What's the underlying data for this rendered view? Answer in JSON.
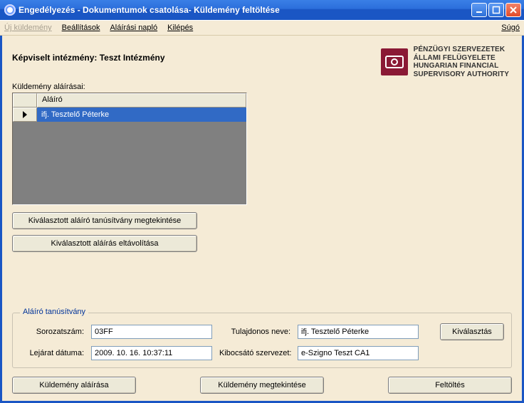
{
  "window": {
    "title": "Engedélyezés - Dokumentumok csatolása- Küldemény feltöltése"
  },
  "menu": {
    "new_shipment": "Új küldemény",
    "settings": "Beállítások",
    "sign_log": "Aláírási napló",
    "exit": "Kilépés",
    "help": "Súgó"
  },
  "authority": {
    "line1": "PÉNZÜGYI SZERVEZETEK",
    "line2": "ÁLLAMI FELÜGYELETE",
    "line3": "HUNGARIAN FINANCIAL",
    "line4": "SUPERVISORY AUTHORITY"
  },
  "header": {
    "institution_label": "Képviselt intézmény: Teszt Intézmény"
  },
  "signers": {
    "section_label": "Küldemény aláírásai:",
    "column_header": "Aláíró",
    "rows": [
      {
        "name": "ifj. Tesztelő Péterke"
      }
    ]
  },
  "buttons": {
    "view_cert": "Kiválasztott aláíró tanúsítvány megtekintése",
    "remove_sig": "Kiválasztott aláírás eltávolítása"
  },
  "cert": {
    "legend": "Aláíró tanúsítvány",
    "serial_label": "Sorozatszám:",
    "serial_value": "03FF",
    "expiry_label": "Lejárat dátuma:",
    "expiry_value": "2009. 10. 16. 10:37:11",
    "owner_label": "Tulajdonos neve:",
    "owner_value": "ifj. Tesztelő Péterke",
    "issuer_label": "Kibocsátó szervezet:",
    "issuer_value": "e-Szigno Teszt CA1",
    "select_button": "Kiválasztás"
  },
  "actions": {
    "sign": "Küldemény aláírása",
    "view": "Küldemény megtekintése",
    "upload": "Feltöltés"
  }
}
